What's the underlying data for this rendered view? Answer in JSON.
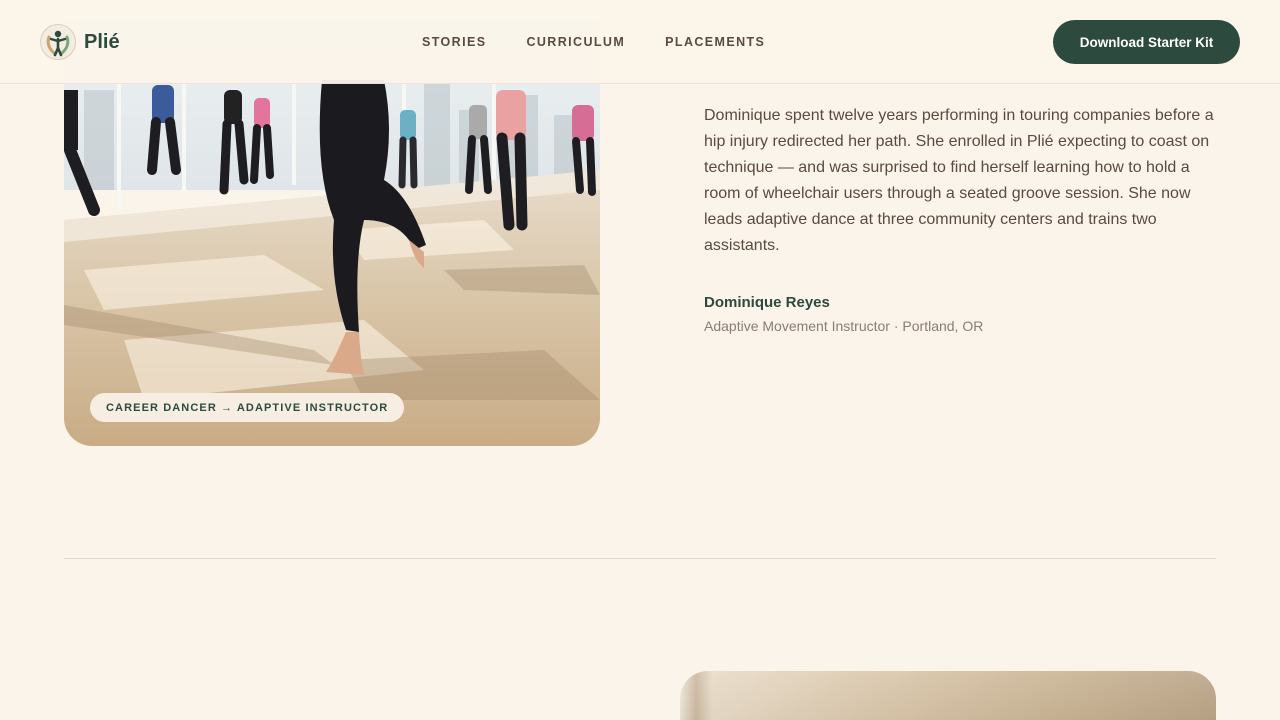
{
  "brand": {
    "name": "Plié",
    "logo_icon": "dancer-figure-icon"
  },
  "nav": {
    "items": [
      {
        "label": "STORIES"
      },
      {
        "label": "CURRICULUM"
      },
      {
        "label": "PLACEMENTS"
      }
    ],
    "cta_label": "Download Starter Kit"
  },
  "story": {
    "image_tag": "CAREER DANCER → ADAPTIVE INSTRUCTOR",
    "body": "Dominique spent twelve years performing in touring companies before a hip injury redirected her path. She enrolled in Plié expecting to coast on technique — and was surprised to find herself learning how to hold a room of wheelchair users through a seated groove session. She now leads adaptive dance at three community centers and trains two assistants.",
    "name": "Dominique Reyes",
    "role": "Adaptive Movement Instructor · Portland, OR"
  },
  "colors": {
    "background": "#fbf4ea",
    "brand_green": "#2c4a3e",
    "body_text": "#5a4a3f",
    "muted_text": "#8a7d72"
  }
}
